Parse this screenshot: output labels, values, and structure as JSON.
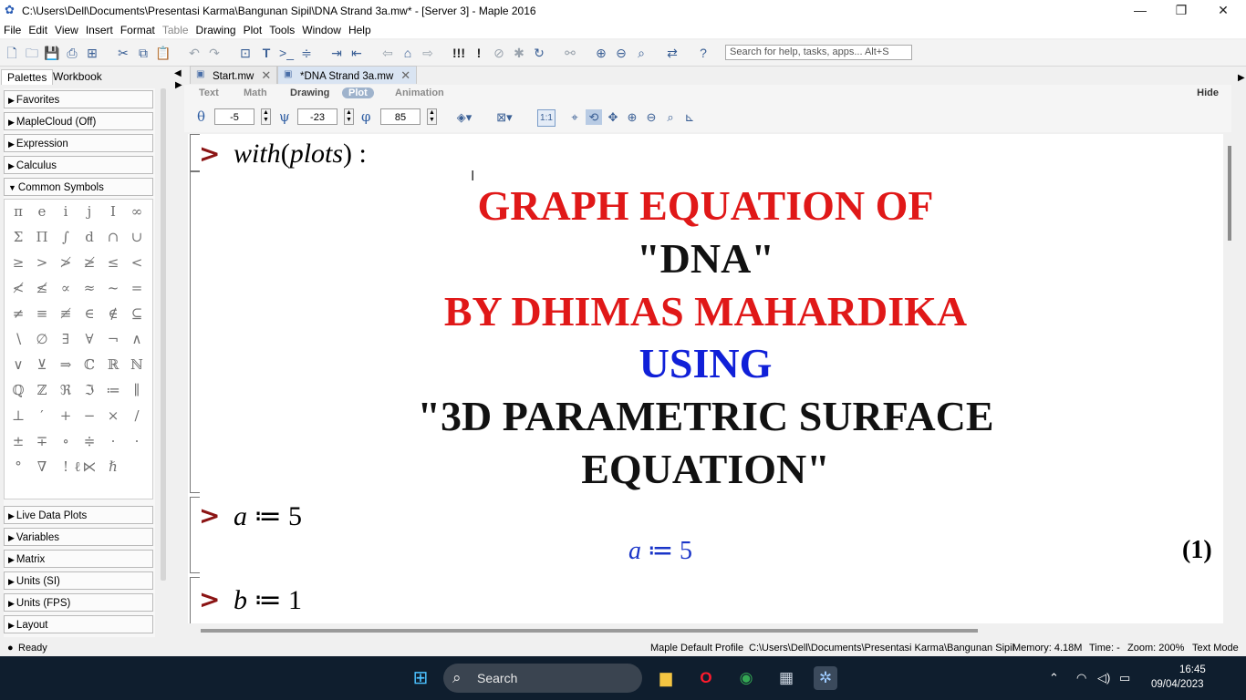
{
  "window": {
    "title": "C:\\Users\\Dell\\Documents\\Presentasi Karma\\Bangunan Sipil\\DNA Strand 3a.mw* - [Server 3] - Maple 2016",
    "minimize": "—",
    "maximize": "❐",
    "close": "✕"
  },
  "menu": [
    "File",
    "Edit",
    "View",
    "Insert",
    "Format",
    "Table",
    "Drawing",
    "Plot",
    "Tools",
    "Window",
    "Help"
  ],
  "search": {
    "placeholder": "Search for help, tasks, apps... Alt+S"
  },
  "palettes": {
    "tabs": [
      "Palettes",
      "Workbook"
    ],
    "sections_top": [
      "Favorites",
      "MapleCloud (Off)",
      "Expression",
      "Calculus",
      "Common Symbols"
    ],
    "symbols": [
      "π",
      "e",
      "i",
      "j",
      "I",
      "∞",
      "Σ",
      "Π",
      "∫",
      "d",
      "∩",
      "∪",
      "≥",
      ">",
      "≯",
      "≱",
      "≤",
      "<",
      "≮",
      "≰",
      "∝",
      "≈",
      "~",
      "=",
      "≠",
      "≡",
      "≢",
      "∈",
      "∉",
      "⊆",
      "∖",
      "∅",
      "∃",
      "∀",
      "¬",
      "∧",
      "∨",
      "⊻",
      "⇒",
      "ℂ",
      "ℝ",
      "ℕ",
      "ℚ",
      "ℤ",
      "ℜ",
      "ℑ",
      "≔",
      "∥",
      "⊥",
      "′",
      "+",
      "−",
      "×",
      "/",
      "±",
      "∓",
      "∘",
      "≑",
      "·",
      "·",
      "°",
      "∇",
      "!",
      "⋉",
      "ℏ",
      "ℓ"
    ],
    "sections_bottom": [
      "Live Data Plots",
      "Variables",
      "Matrix",
      "Units (SI)",
      "Units (FPS)",
      "Layout"
    ]
  },
  "doc_tabs": [
    {
      "label": "Start.mw",
      "close": "✕"
    },
    {
      "label": "*DNA Strand 3a.mw",
      "close": "✕"
    }
  ],
  "context": {
    "modes": [
      "Text",
      "Math",
      "Drawing",
      "Plot",
      "Animation"
    ],
    "active_mode": "Plot",
    "hide": "Hide",
    "theta_symbol": "θ",
    "theta": "-5",
    "psi_symbol": "ψ",
    "psi": "-23",
    "phi_symbol": "φ",
    "phi": "85",
    "scale_label": "1:1"
  },
  "document": {
    "cmd1": {
      "fn": "with",
      "arg": "plots",
      "lparen": "(",
      "rparen": ")",
      "colon": ":"
    },
    "heading": {
      "line1": "GRAPH EQUATION OF",
      "line2": "\"DNA\"",
      "line3": "BY DHIMAS MAHARDIKA",
      "line4": "USING",
      "line5": "\"3D PARAMETRIC SURFACE",
      "line6": "EQUATION\"",
      "color_red": "#e01818",
      "color_blue": "#1020d8"
    },
    "cmd2": {
      "var": "a",
      "assign": "≔",
      "value": "5"
    },
    "out2": {
      "var": "a",
      "assign": "≔",
      "value": "5",
      "label": "(1)"
    },
    "cmd3": {
      "var": "b",
      "assign": "≔",
      "value": "1"
    },
    "prompt": ">"
  },
  "status": {
    "state": "Ready",
    "profile": "Maple Default Profile",
    "path": "C:\\Users\\Dell\\Documents\\Presentasi Karma\\Bangunan Sipil",
    "memory": "Memory: 4.18M",
    "time": "Time: -",
    "zoom": "Zoom: 200%",
    "mode": "Text Mode"
  },
  "taskbar": {
    "search_label": "Search",
    "time": "16:45",
    "date": "09/04/2023"
  }
}
